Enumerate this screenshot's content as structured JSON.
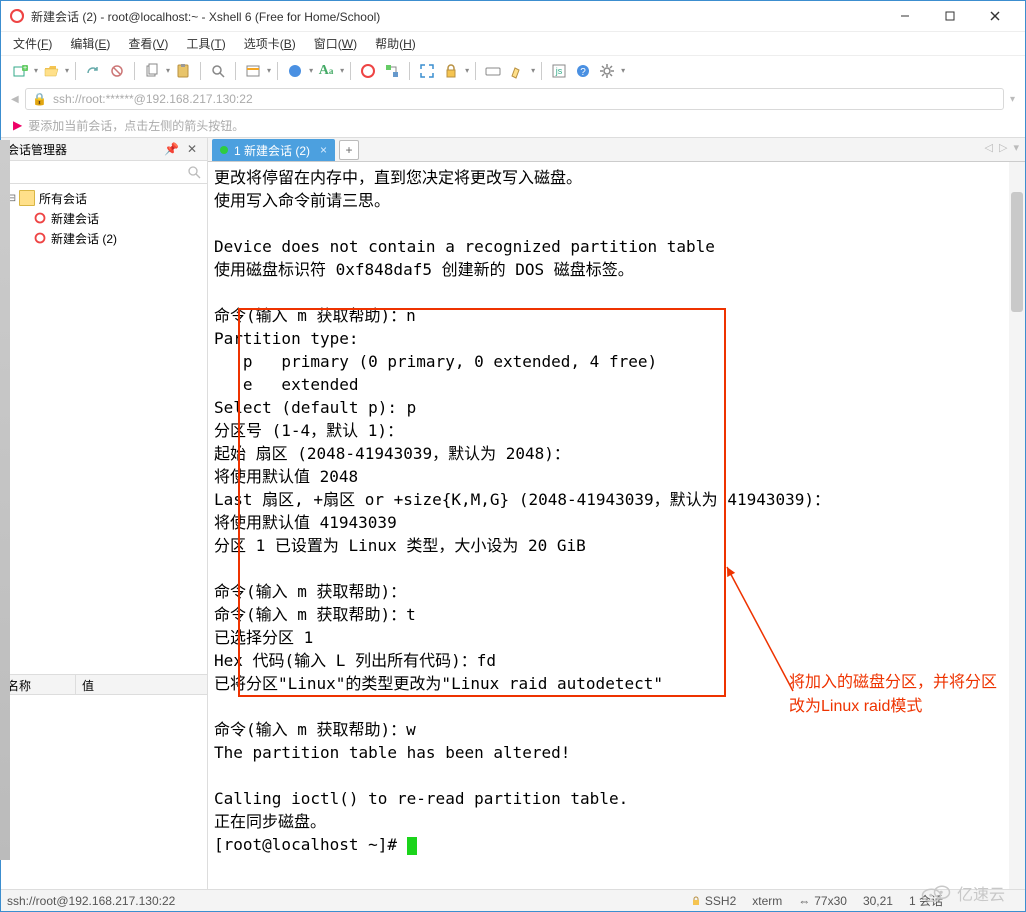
{
  "window": {
    "title": "新建会话 (2) - root@localhost:~ - Xshell 6 (Free for Home/School)"
  },
  "menubar": {
    "file": "文件(",
    "file_k": "F",
    "file_e": ")",
    "edit": "编辑(",
    "edit_k": "E",
    "edit_e": ")",
    "view": "查看(",
    "view_k": "V",
    "view_e": ")",
    "tools": "工具(",
    "tools_k": "T",
    "tools_e": ")",
    "tab": "选项卡(",
    "tab_k": "B",
    "tab_e": ")",
    "window": "窗口(",
    "window_k": "W",
    "window_e": ")",
    "help": "帮助(",
    "help_k": "H",
    "help_e": ")"
  },
  "address": "ssh://root:******@192.168.217.130:22",
  "hint": "要添加当前会话，点击左侧的箭头按钮。",
  "sidebar": {
    "title": "会话管理器",
    "tree": {
      "root": "所有会话",
      "items": [
        "新建会话",
        "新建会话 (2)"
      ]
    },
    "cols": {
      "name": "名称",
      "value": "值"
    }
  },
  "tab": {
    "label": "1 新建会话 (2)"
  },
  "terminal_lines": [
    "更改将停留在内存中，直到您决定将更改写入磁盘。",
    "使用写入命令前请三思。",
    "",
    "Device does not contain a recognized partition table",
    "使用磁盘标识符 0xf848daf5 创建新的 DOS 磁盘标签。",
    "",
    "命令(输入 m 获取帮助)：n",
    "Partition type:",
    "   p   primary (0 primary, 0 extended, 4 free)",
    "   e   extended",
    "Select (default p): p",
    "分区号 (1-4，默认 1)：",
    "起始 扇区 (2048-41943039，默认为 2048)：",
    "将使用默认值 2048",
    "Last 扇区, +扇区 or +size{K,M,G} (2048-41943039，默认为 41943039)：",
    "将使用默认值 41943039",
    "分区 1 已设置为 Linux 类型，大小设为 20 GiB",
    "",
    "命令(输入 m 获取帮助)：",
    "命令(输入 m 获取帮助)：t",
    "已选择分区 1",
    "Hex 代码(输入 L 列出所有代码)：fd",
    "已将分区\"Linux\"的类型更改为\"Linux raid autodetect\"",
    "",
    "命令(输入 m 获取帮助)：w",
    "The partition table has been altered!",
    "",
    "Calling ioctl() to re-read partition table.",
    "正在同步磁盘。",
    "[root@localhost ~]# "
  ],
  "annotation": "将加入的磁盘分区，并将分区改为Linux raid模式",
  "status": {
    "conn": "ssh://root@192.168.217.130:22",
    "proto": "SSH2",
    "term": "xterm",
    "size": "77x30",
    "pos": "30,21",
    "sess": "1 会话"
  },
  "watermark": "亿速云"
}
